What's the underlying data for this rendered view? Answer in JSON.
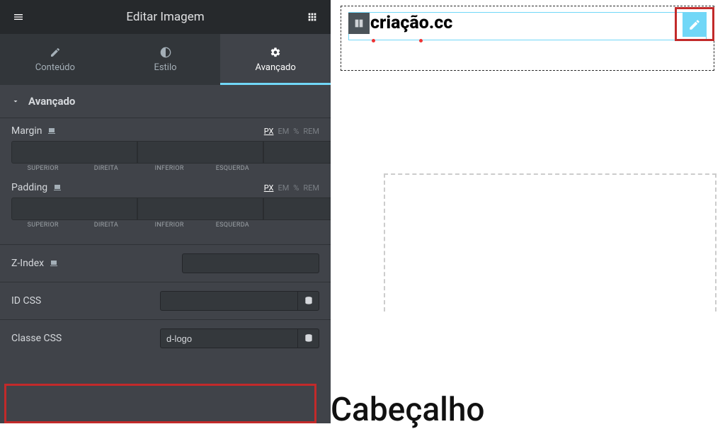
{
  "header": {
    "title": "Editar Imagem"
  },
  "tabs": [
    {
      "label": "Conteúdo",
      "icon": "pencil-icon"
    },
    {
      "label": "Estilo",
      "icon": "contrast-icon"
    },
    {
      "label": "Avançado",
      "icon": "gear-icon"
    }
  ],
  "section": {
    "title": "Avançado"
  },
  "margin": {
    "label": "Margin",
    "units": [
      "PX",
      "EM",
      "%",
      "REM"
    ],
    "active_unit": "PX",
    "sides": [
      "SUPERIOR",
      "DIREITA",
      "INFERIOR",
      "ESQUERDA"
    ]
  },
  "padding": {
    "label": "Padding",
    "units": [
      "PX",
      "EM",
      "%",
      "REM"
    ],
    "active_unit": "PX",
    "sides": [
      "SUPERIOR",
      "DIREITA",
      "INFERIOR",
      "ESQUERDA"
    ]
  },
  "zindex": {
    "label": "Z-Index",
    "value": ""
  },
  "idcss": {
    "label": "ID CSS",
    "value": ""
  },
  "classecss": {
    "label": "Classe CSS",
    "value": "d-logo"
  },
  "canvas": {
    "logo_text": "criação.cc",
    "heading": "Cabeçalho"
  }
}
